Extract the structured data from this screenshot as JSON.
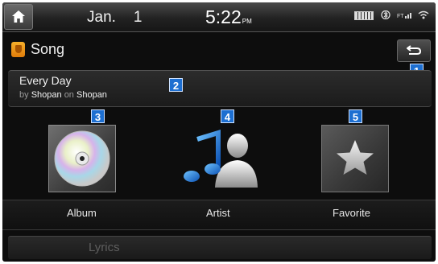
{
  "status": {
    "date_month": "Jan.",
    "date_day": "1",
    "time": "5:22",
    "ampm": "PM",
    "icons": [
      "battery-icon",
      "bluetooth-icon",
      "network-icon",
      "wifi-icon"
    ]
  },
  "header": {
    "title": "Song",
    "back_badge": "1"
  },
  "now_playing": {
    "badge": "2",
    "track": "Every Day",
    "by_word": "by",
    "artist": "Shopan",
    "on_word": "on",
    "album": "Shopan"
  },
  "tiles": [
    {
      "badge": "3",
      "label": "Album",
      "icon": "cd-disc-icon"
    },
    {
      "badge": "4",
      "label": "Artist",
      "icon": "artist-music-icon"
    },
    {
      "badge": "5",
      "label": "Favorite",
      "icon": "star-icon"
    }
  ],
  "lyrics": {
    "label": "Lyrics"
  },
  "colors": {
    "badge": "#1d6fd1",
    "song_icon": "#f7a21b",
    "background": "#0d0d0d"
  }
}
